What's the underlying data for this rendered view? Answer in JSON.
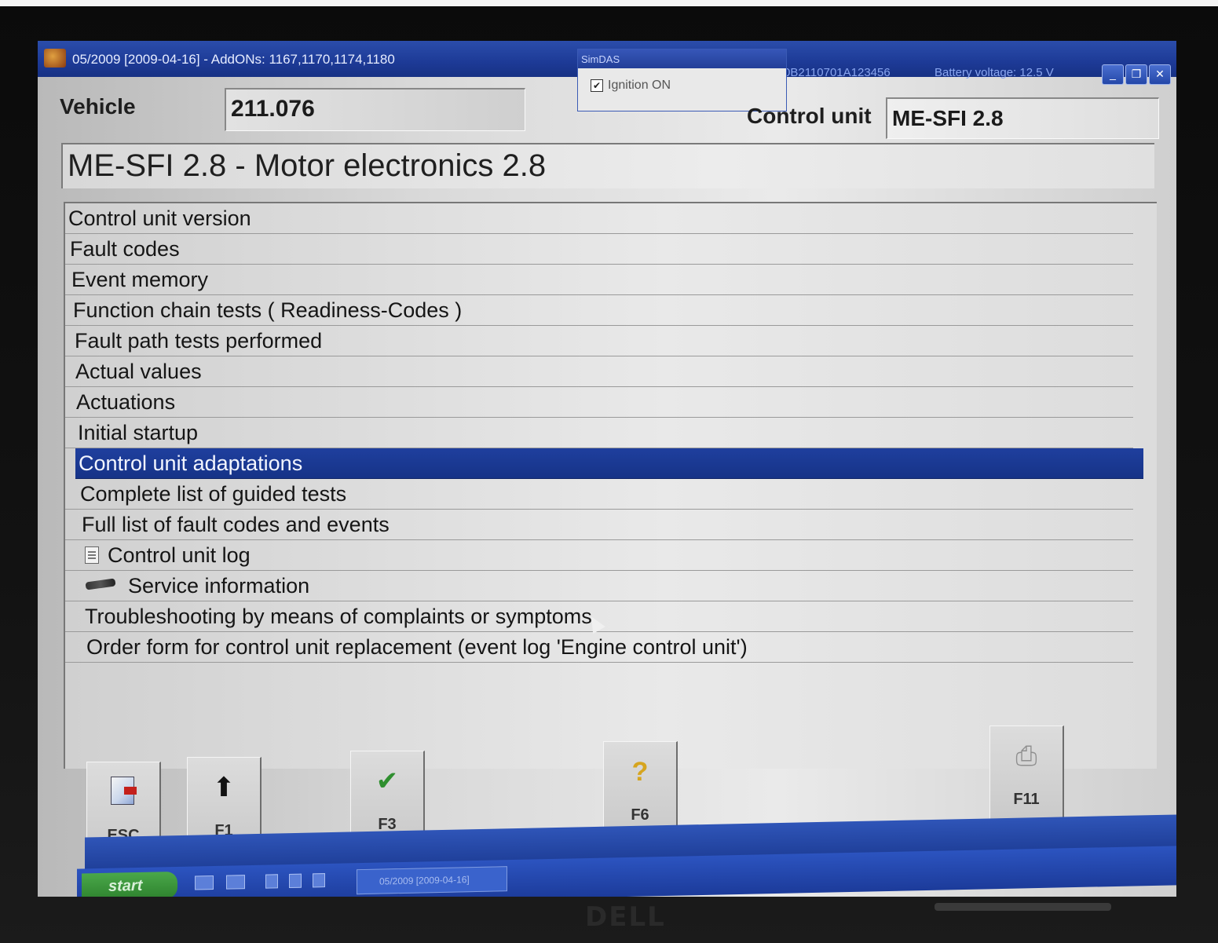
{
  "window": {
    "title": "05/2009 [2009-04-16] - AddONs: 1167,1170,1174,1180",
    "right_info": "0B2110701A123456",
    "battery": "Battery voltage: 12.5 V"
  },
  "simdas": {
    "title": "SimDAS",
    "ignition_label": "Ignition ON",
    "ignition_checked": true
  },
  "header": {
    "vehicle_label": "Vehicle",
    "vehicle_value": "211.076",
    "control_unit_label": "Control unit",
    "control_unit_value": "ME-SFI 2.8"
  },
  "module_title": "ME-SFI 2.8 - Motor electronics 2.8",
  "menu": {
    "items": [
      {
        "label": "Control unit version"
      },
      {
        "label": "Fault codes"
      },
      {
        "label": "Event memory"
      },
      {
        "label": "Function chain tests ( Readiness-Codes )"
      },
      {
        "label": "Fault path tests performed"
      },
      {
        "label": "Actual values"
      },
      {
        "label": "Actuations"
      },
      {
        "label": "Initial startup"
      },
      {
        "label": "Control unit adaptations",
        "selected": true
      },
      {
        "label": "Complete list of guided tests"
      },
      {
        "label": "Full list of fault codes and events"
      },
      {
        "label": "Control unit log",
        "icon": "document-icon"
      },
      {
        "label": "Service information",
        "icon": "wrench-icon"
      },
      {
        "label": "Troubleshooting by means of complaints or symptoms"
      },
      {
        "label": "Order form for control unit replacement (event log 'Engine control unit')"
      }
    ]
  },
  "function_keys": [
    {
      "key": "ESC",
      "icon": "exit-door-icon"
    },
    {
      "key": "F1",
      "icon": "arrow-up-icon"
    },
    {
      "key": "F3",
      "icon": "checkmark-icon"
    },
    {
      "key": "F6",
      "icon": "help-question-icon"
    },
    {
      "key": "F11",
      "icon": "printer-icon"
    }
  ],
  "taskbar": {
    "start_label": "start",
    "task_item_label": "05/2009 [2009-04-16]"
  },
  "bezel": {
    "brand": "DELL"
  },
  "colors": {
    "titlebar": "#1d3a96",
    "selection": "#1a3890",
    "screen_bg": "#dcdcdc",
    "taskbar": "#2448a8",
    "start_button": "#3a953a"
  }
}
